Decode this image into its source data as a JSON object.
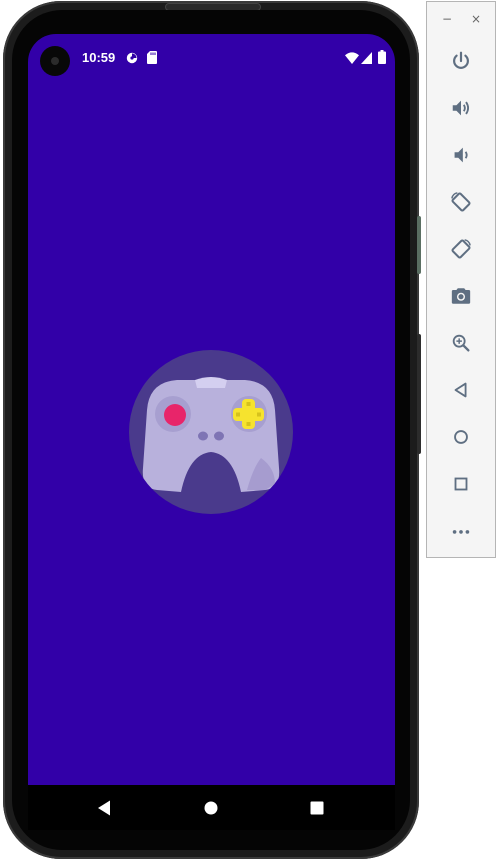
{
  "status_bar": {
    "time": "10:59",
    "left_icons": [
      "data-saver-icon",
      "sd-card-icon"
    ],
    "right_icons": [
      "wifi-icon",
      "cellular-signal-icon",
      "battery-icon"
    ]
  },
  "screen": {
    "background_color": "#3200a8",
    "logo": "game-controller-icon"
  },
  "navigation_bar": {
    "buttons": [
      "back-icon",
      "home-icon",
      "recents-icon"
    ]
  },
  "emulator_toolbar": {
    "window_controls": {
      "minimize": "−",
      "close": "×"
    },
    "tools": [
      "power-icon",
      "volume-up-icon",
      "volume-down-icon",
      "rotate-left-icon",
      "rotate-right-icon",
      "screenshot-icon",
      "zoom-icon",
      "back-icon",
      "home-icon",
      "overview-icon",
      "more-icon"
    ]
  }
}
